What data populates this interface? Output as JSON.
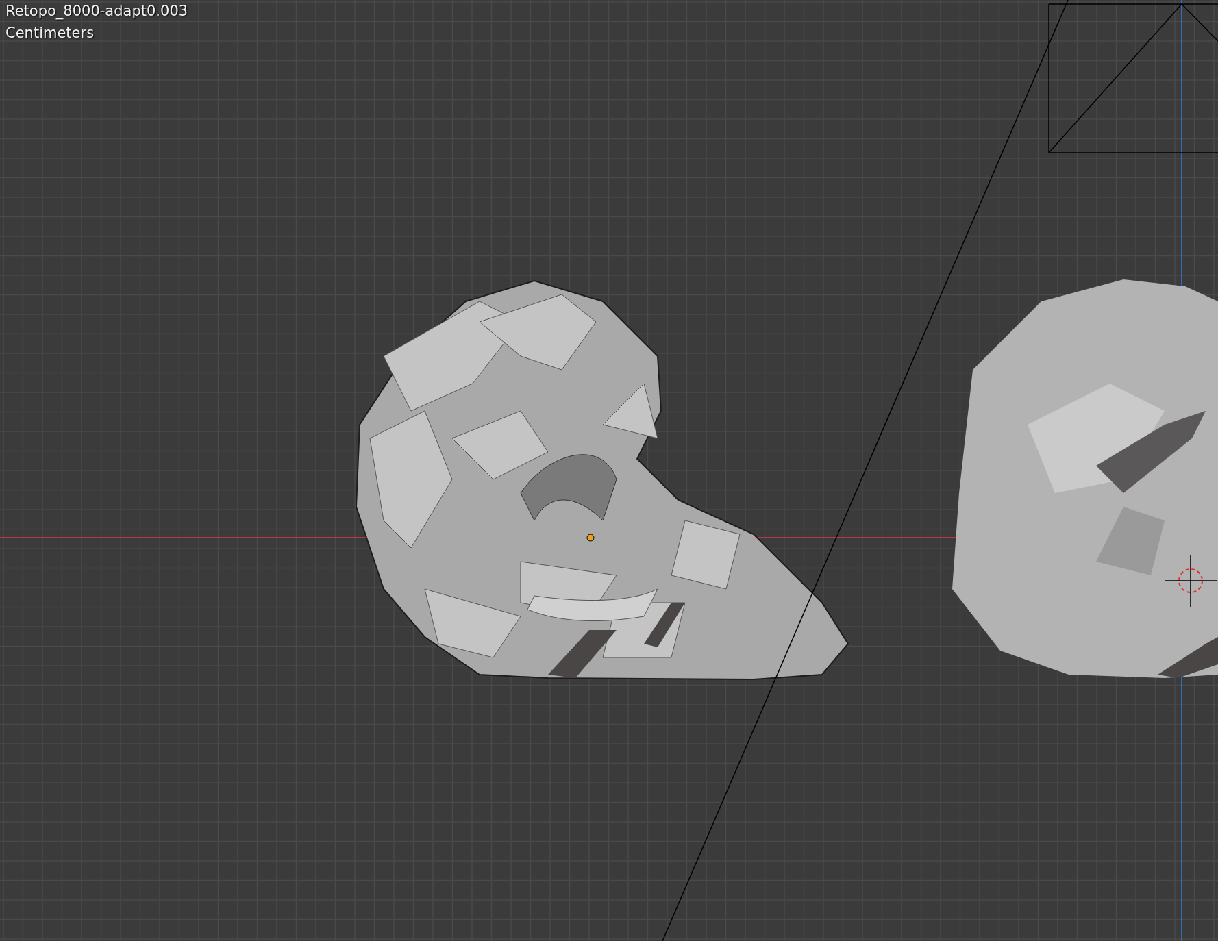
{
  "viewport": {
    "object_name": "Retopo_8000-adapt0.003",
    "units": "Centimeters"
  }
}
